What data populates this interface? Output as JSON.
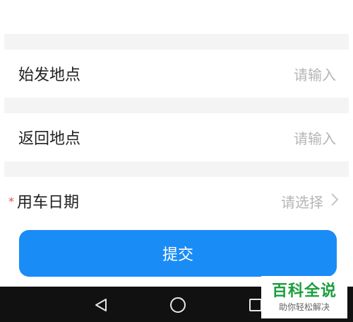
{
  "form": {
    "start_location": {
      "label": "始发地点",
      "placeholder": "请输入"
    },
    "return_location": {
      "label": "返回地点",
      "placeholder": "请输入"
    },
    "date": {
      "required_mark": "*",
      "label": "用车日期",
      "placeholder": "请选择"
    },
    "submit_label": "提交"
  },
  "navbar": {
    "icons": [
      "back-triangle-icon",
      "home-circle-icon",
      "recent-square-icon"
    ]
  },
  "watermark": {
    "title": "百科全说",
    "subtitle": "助你轻松解决"
  },
  "colors": {
    "accent": "#1a8cf6",
    "required": "#e0524a",
    "placeholder": "#b5b5b5",
    "watermark": "#1a9e3c"
  }
}
